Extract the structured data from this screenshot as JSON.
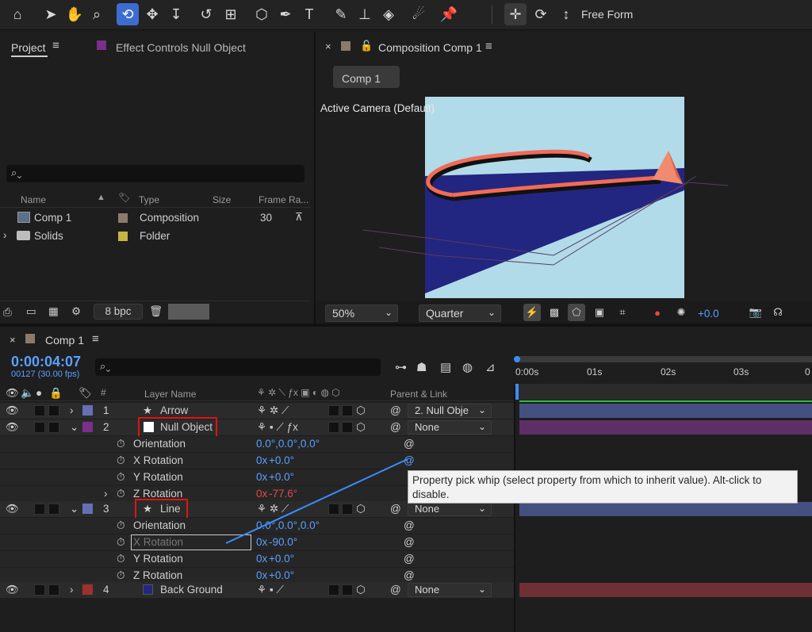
{
  "toolbar": {
    "tools": [
      "home-icon",
      "selection-icon",
      "hand-icon",
      "zoom-icon",
      "orbit-camera-icon",
      "pan-camera-icon",
      "dolly-camera-icon",
      "rotate-icon",
      "pan-behind-icon",
      "shape-icon",
      "pen-icon",
      "type-icon",
      "brush-icon",
      "clone-stamp-icon",
      "eraser-icon",
      "roto-brush-icon",
      "puppet-pin-icon"
    ],
    "active_tool": "orbit-camera-icon",
    "free_form_label": "Free Form"
  },
  "project_panel": {
    "tab_project": "Project",
    "tab_effect_controls": "Effect Controls Null Object",
    "columns": {
      "name": "Name",
      "type": "Type",
      "size": "Size",
      "frame_rate": "Frame Ra..."
    },
    "items": [
      {
        "name": "Comp 1",
        "type": "Composition",
        "frame_rate": "30",
        "label_color": "#8c7b6b"
      },
      {
        "name": "Solids",
        "type": "Folder",
        "frame_rate": "",
        "label_color": "#c7b443"
      }
    ],
    "bpc": "8 bpc"
  },
  "composition_panel": {
    "tab_title": "Composition Comp 1",
    "comp_tab": "Comp 1",
    "camera_label": "Active Camera (Default)",
    "zoom": "50%",
    "resolution": "Quarter",
    "exposure": "+0.0",
    "colors": {
      "sky": "#b1dbe9",
      "plane": "#222680",
      "stroke": "#f26b57"
    }
  },
  "timeline": {
    "tab_title": "Comp 1",
    "timecode": "0:00:04:07",
    "frame_info": "00127 (30.00 fps)",
    "col_layer_name": "Layer Name",
    "col_num": "#",
    "col_parent": "Parent & Link",
    "ruler": [
      "0:00s",
      "01s",
      "02s",
      "03s",
      "0"
    ],
    "layers": [
      {
        "num": "1",
        "name": "Arrow",
        "parent": "2. Null Obje",
        "label_color": "#6670b4",
        "bar_color": "#44507f"
      },
      {
        "num": "2",
        "name": "Null Object",
        "parent": "None",
        "label_color": "#7a2f8b",
        "bar_color": "#5e2f67"
      },
      {
        "num": "3",
        "name": "Line",
        "parent": "None",
        "label_color": "#6670b4",
        "bar_color": "#44507f"
      },
      {
        "num": "4",
        "name": "Back Ground",
        "parent": "None",
        "label_color": "#a0302f",
        "bar_color": "#6e3034"
      }
    ],
    "null_props": [
      {
        "name": "Orientation",
        "value": "0.0°,0.0°,0.0°"
      },
      {
        "name": "X Rotation",
        "value_a": "0x",
        "value_b": "+0.0°"
      },
      {
        "name": "Y Rotation",
        "value_a": "0x",
        "value_b": "+0.0°"
      },
      {
        "name": "Z Rotation",
        "value_a": "0x",
        "value_b": "-77.6°"
      }
    ],
    "line_props": [
      {
        "name": "Orientation",
        "value": "0.0°,0.0°,0.0°"
      },
      {
        "name": "X Rotation",
        "value_a": "0x",
        "value_b": "-90.0°"
      },
      {
        "name": "Y Rotation",
        "value_a": "0x",
        "value_b": "+0.0°"
      },
      {
        "name": "Z Rotation",
        "value_a": "0x",
        "value_b": "+0.0°"
      }
    ],
    "tooltip": "Property pick whip (select property from which to inherit value). Alt-click to disable."
  }
}
